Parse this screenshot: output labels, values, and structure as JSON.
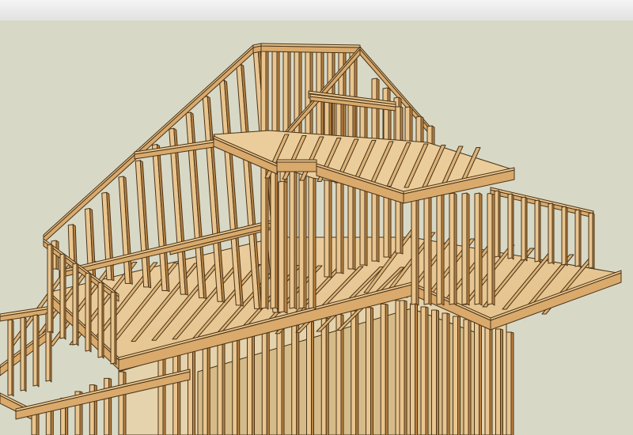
{
  "colors": {
    "sky": "#f1f1f1",
    "ground": "#d8d8c6",
    "lumber_light": "#e9c58f",
    "lumber_mid": "#d9aa6c",
    "lumber_dark": "#b98344",
    "edge": "#4a3418"
  },
  "icons": [
    "house-framing-model"
  ]
}
